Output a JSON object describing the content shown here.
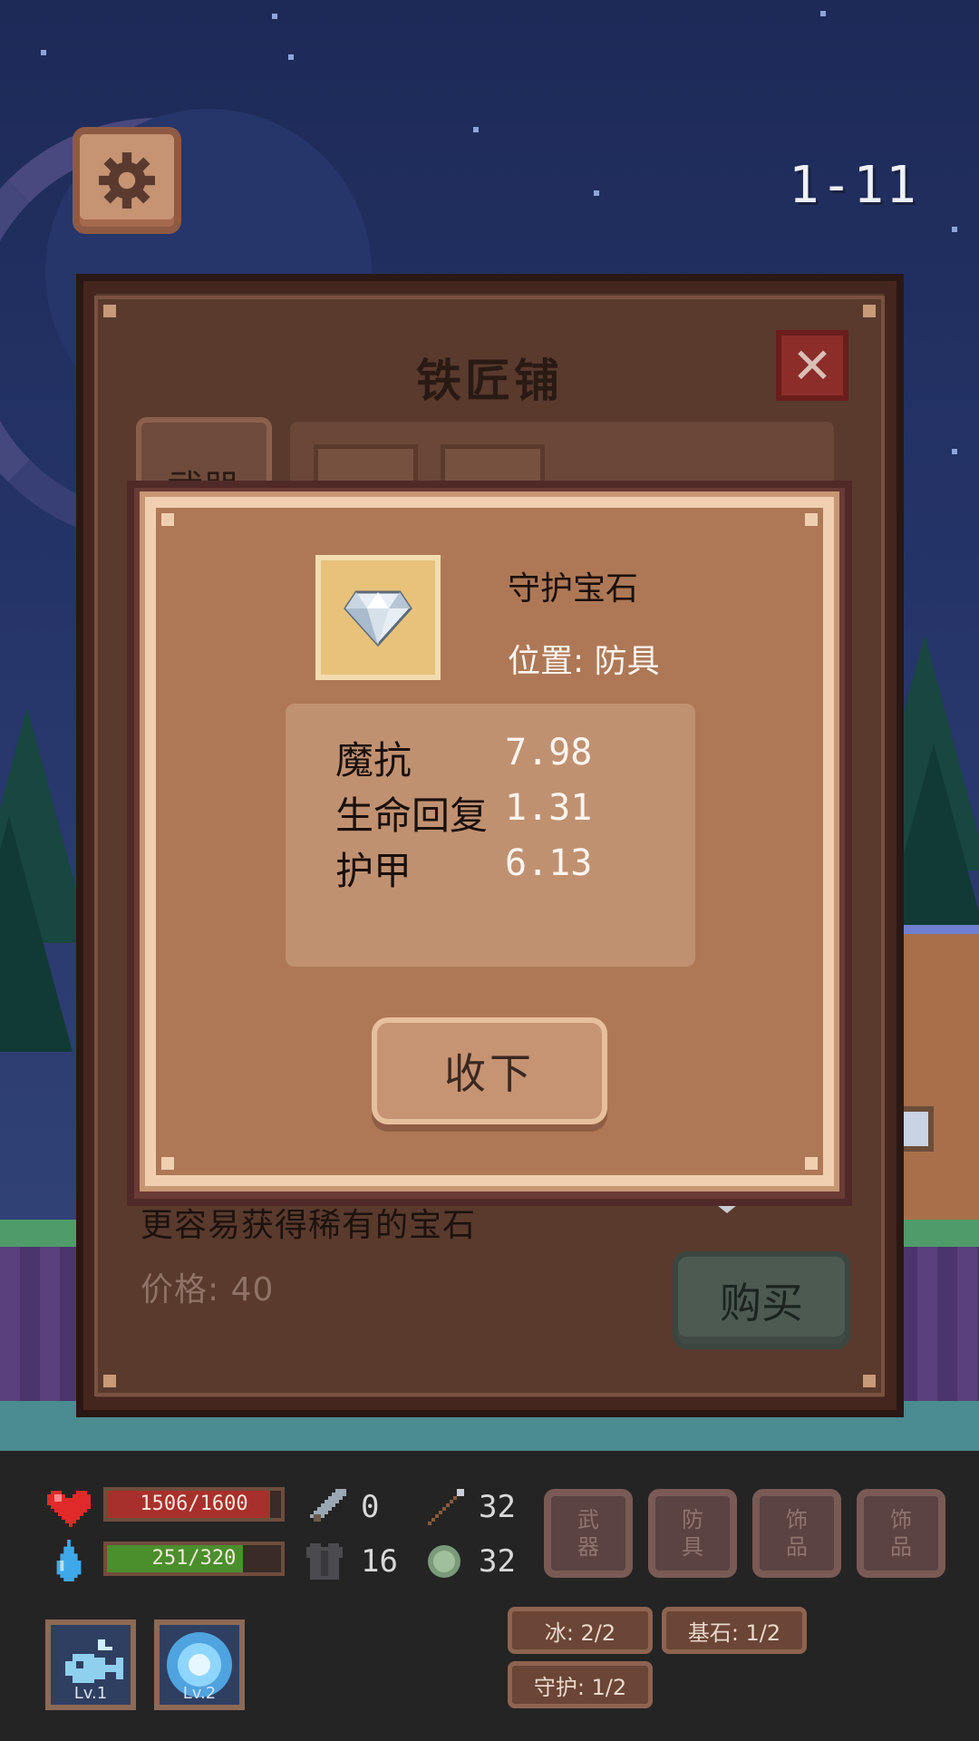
{
  "hud": {
    "level": "1-11",
    "hp_text": "1506/1600",
    "hp_fraction": 0.94,
    "mp_text": "251/320",
    "mp_fraction": 0.78,
    "attack": "0",
    "attack2": "32",
    "defense": "16",
    "magic_res": "32"
  },
  "equip_slots": [
    {
      "line1": "武",
      "line2": "器"
    },
    {
      "line1": "防",
      "line2": "具"
    },
    {
      "line1": "饰",
      "line2": "品"
    },
    {
      "line1": "饰",
      "line2": "品"
    }
  ],
  "skills": [
    {
      "level": "Lv.1"
    },
    {
      "level": "Lv.2"
    }
  ],
  "set_tags": [
    "冰: 2/2",
    "基石: 1/2",
    "守护: 1/2"
  ],
  "shop": {
    "title": "铁匠铺",
    "tab_weapon": "武器",
    "description": "更容易获得稀有的宝石",
    "price": "价格: 40",
    "buy_label": "购买"
  },
  "popup": {
    "item_name": "守护宝石",
    "slot_label": "位置: 防具",
    "stats": [
      {
        "name": "魔抗",
        "value": "7.98"
      },
      {
        "name": "生命回复",
        "value": "1.31"
      },
      {
        "name": "护甲",
        "value": "6.13"
      }
    ],
    "accept_label": "收下"
  },
  "colors": {
    "hp_fill": "#a8302c",
    "mp_fill": "#4a8f2c",
    "popup_bg": "#ae7856",
    "shop_bg": "#5a3a2d"
  }
}
